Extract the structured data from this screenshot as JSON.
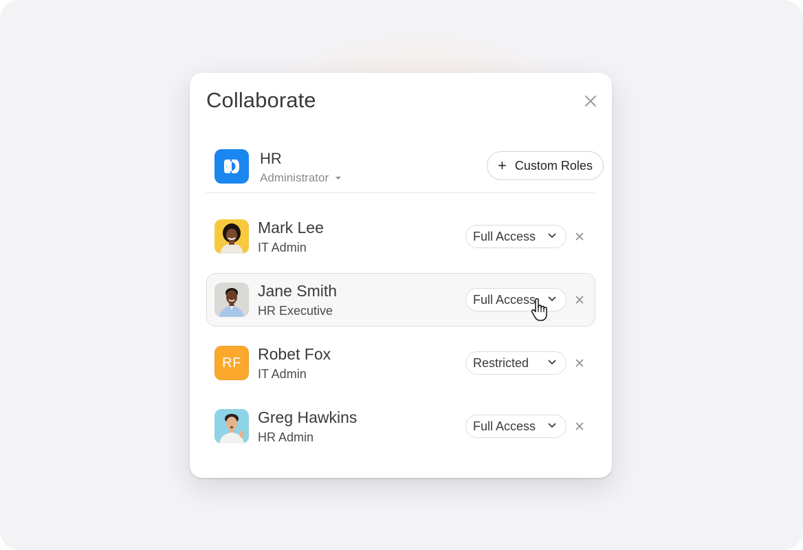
{
  "dialog": {
    "title": "Collaborate"
  },
  "org": {
    "name": "HR",
    "role": "Administrator",
    "custom_roles_label": "Custom Roles"
  },
  "members": [
    {
      "name": "Mark Lee",
      "title": "IT Admin",
      "access": "Full Access",
      "avatar": "photo"
    },
    {
      "name": "Jane Smith",
      "title": "HR Executive",
      "access": "Full Access",
      "avatar": "photo"
    },
    {
      "name": "Robet Fox",
      "title": "IT Admin",
      "access": "Restricted",
      "avatar": "initials",
      "initials": "RF"
    },
    {
      "name": "Greg Hawkins",
      "title": "HR Admin",
      "access": "Full Access",
      "avatar": "photo"
    }
  ],
  "colors": {
    "org_logo": "#1a86f0",
    "initials_avatar": "#fba82c",
    "hover_row": "#f7f7f8"
  },
  "icons": {
    "close": "close-icon",
    "plus": "plus-icon",
    "chevron": "chevron-down-icon",
    "remove": "remove-icon",
    "cursor": "hand-pointer-cursor"
  }
}
